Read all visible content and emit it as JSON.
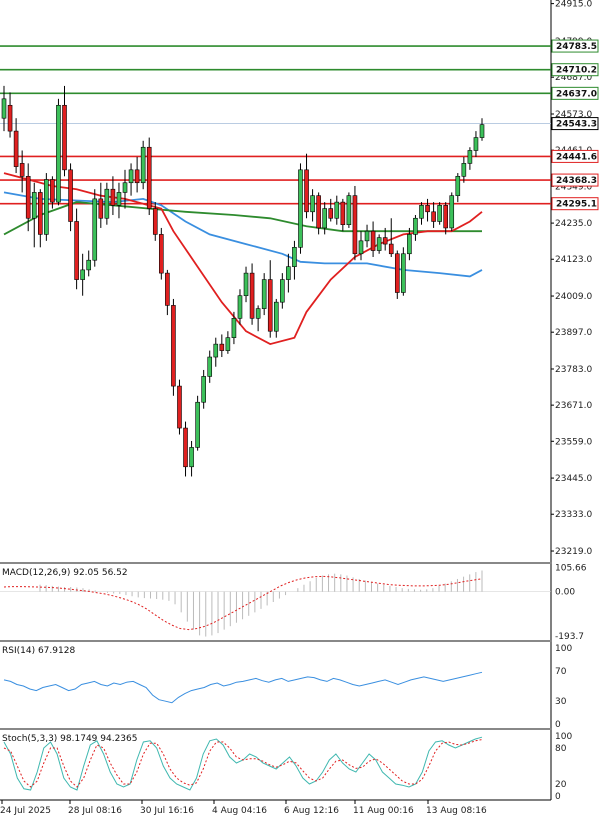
{
  "chart_data": {
    "type": "candlestick",
    "price_axis": {
      "ticks": [
        "24915.0",
        "24799.0",
        "24687.0",
        "24573.0",
        "24461.0",
        "24349.0",
        "24235.0",
        "24123.0",
        "24009.0",
        "23897.0",
        "23783.0",
        "23671.0",
        "23559.0",
        "23445.0",
        "23333.0",
        "23219.0"
      ],
      "range": [
        23185,
        24920
      ]
    },
    "date_labels": [
      "24 Jul 2025",
      "28 Jul 08:16",
      "30 Jul 16:16",
      "4 Aug 04:16",
      "6 Aug 12:16",
      "11 Aug 00:16",
      "13 Aug 08:16"
    ],
    "candles": [
      [
        24560,
        24660,
        24520,
        24620
      ],
      [
        24600,
        24640,
        24500,
        24520
      ],
      [
        24520,
        24560,
        24390,
        24410
      ],
      [
        24420,
        24460,
        24330,
        24380
      ],
      [
        24380,
        24420,
        24210,
        24250
      ],
      [
        24250,
        24360,
        24160,
        24330
      ],
      [
        24330,
        24340,
        24160,
        24200
      ],
      [
        24200,
        24390,
        24180,
        24370
      ],
      [
        24370,
        24380,
        24280,
        24300
      ],
      [
        24300,
        24620,
        24290,
        24600
      ],
      [
        24600,
        24660,
        24380,
        24400
      ],
      [
        24400,
        24420,
        24210,
        24240
      ],
      [
        24240,
        24280,
        24030,
        24060
      ],
      [
        24060,
        24140,
        24010,
        24090
      ],
      [
        24090,
        24150,
        24070,
        24120
      ],
      [
        24120,
        24340,
        24100,
        24310
      ],
      [
        24310,
        24360,
        24220,
        24250
      ],
      [
        24250,
        24360,
        24230,
        24340
      ],
      [
        24340,
        24380,
        24260,
        24290
      ],
      [
        24290,
        24360,
        24250,
        24330
      ],
      [
        24330,
        24400,
        24280,
        24360
      ],
      [
        24360,
        24420,
        24320,
        24400
      ],
      [
        24400,
        24440,
        24330,
        24360
      ],
      [
        24360,
        24490,
        24340,
        24470
      ],
      [
        24470,
        24500,
        24260,
        24280
      ],
      [
        24280,
        24300,
        24180,
        24200
      ],
      [
        24200,
        24220,
        24060,
        24080
      ],
      [
        24080,
        24090,
        23950,
        23980
      ],
      [
        23980,
        24000,
        23700,
        23730
      ],
      [
        23730,
        23750,
        23580,
        23600
      ],
      [
        23600,
        23620,
        23450,
        23480
      ],
      [
        23480,
        23560,
        23450,
        23540
      ],
      [
        23540,
        23700,
        23530,
        23680
      ],
      [
        23680,
        23780,
        23660,
        23760
      ],
      [
        23760,
        23840,
        23740,
        23820
      ],
      [
        23820,
        23880,
        23790,
        23860
      ],
      [
        23860,
        23890,
        23820,
        23840
      ],
      [
        23840,
        23900,
        23830,
        23880
      ],
      [
        23880,
        23960,
        23860,
        23940
      ],
      [
        23940,
        24030,
        23920,
        24010
      ],
      [
        24010,
        24100,
        23990,
        24080
      ],
      [
        24080,
        24110,
        23920,
        23940
      ],
      [
        23940,
        23980,
        23900,
        23970
      ],
      [
        23970,
        24080,
        23950,
        24060
      ],
      [
        24060,
        24120,
        23880,
        23900
      ],
      [
        23900,
        24000,
        23880,
        23990
      ],
      [
        23990,
        24080,
        23970,
        24060
      ],
      [
        24060,
        24140,
        24020,
        24100
      ],
      [
        24100,
        24180,
        24060,
        24160
      ],
      [
        24160,
        24420,
        24140,
        24400
      ],
      [
        24400,
        24450,
        24250,
        24270
      ],
      [
        24270,
        24340,
        24240,
        24320
      ],
      [
        24320,
        24330,
        24200,
        24220
      ],
      [
        24220,
        24300,
        24200,
        24280
      ],
      [
        24280,
        24310,
        24240,
        24250
      ],
      [
        24250,
        24320,
        24230,
        24300
      ],
      [
        24300,
        24310,
        24210,
        24230
      ],
      [
        24230,
        24330,
        24220,
        24320
      ],
      [
        24320,
        24350,
        24120,
        24140
      ],
      [
        24140,
        24210,
        24120,
        24180
      ],
      [
        24180,
        24230,
        24160,
        24210
      ],
      [
        24210,
        24240,
        24130,
        24150
      ],
      [
        24150,
        24200,
        24140,
        24190
      ],
      [
        24190,
        24220,
        24150,
        24170
      ],
      [
        24170,
        24250,
        24130,
        24140
      ],
      [
        24140,
        24150,
        24000,
        24020
      ],
      [
        24020,
        24160,
        24010,
        24140
      ],
      [
        24140,
        24220,
        24120,
        24200
      ],
      [
        24200,
        24260,
        24180,
        24250
      ],
      [
        24250,
        24300,
        24230,
        24290
      ],
      [
        24290,
        24310,
        24240,
        24270
      ],
      [
        24270,
        24300,
        24220,
        24240
      ],
      [
        24240,
        24300,
        24230,
        24290
      ],
      [
        24290,
        24300,
        24200,
        24220
      ],
      [
        24220,
        24330,
        24210,
        24320
      ],
      [
        24320,
        24390,
        24300,
        24380
      ],
      [
        24380,
        24440,
        24360,
        24420
      ],
      [
        24420,
        24470,
        24400,
        24460
      ],
      [
        24460,
        24520,
        24440,
        24500
      ],
      [
        24500,
        24560,
        24490,
        24540
      ]
    ],
    "ma_blue": [
      [
        0,
        24330
      ],
      [
        6,
        24310
      ],
      [
        12,
        24305
      ],
      [
        18,
        24300
      ],
      [
        23,
        24310
      ],
      [
        26,
        24290
      ],
      [
        30,
        24240
      ],
      [
        34,
        24200
      ],
      [
        40,
        24170
      ],
      [
        46,
        24140
      ],
      [
        49,
        24115
      ],
      [
        53,
        24110
      ],
      [
        60,
        24110
      ],
      [
        66,
        24090
      ],
      [
        72,
        24080
      ],
      [
        77,
        24070
      ],
      [
        79,
        24090
      ]
    ],
    "ma_green": [
      [
        0,
        24200
      ],
      [
        6,
        24260
      ],
      [
        12,
        24300
      ],
      [
        18,
        24290
      ],
      [
        24,
        24280
      ],
      [
        30,
        24270
      ],
      [
        38,
        24260
      ],
      [
        44,
        24250
      ],
      [
        50,
        24225
      ],
      [
        56,
        24210
      ],
      [
        64,
        24210
      ],
      [
        72,
        24210
      ],
      [
        79,
        24210
      ]
    ],
    "ma_red": [
      [
        0,
        24390
      ],
      [
        4,
        24370
      ],
      [
        8,
        24350
      ],
      [
        12,
        24340
      ],
      [
        16,
        24320
      ],
      [
        20,
        24310
      ],
      [
        26,
        24280
      ],
      [
        28,
        24210
      ],
      [
        32,
        24100
      ],
      [
        36,
        23990
      ],
      [
        40,
        23900
      ],
      [
        44,
        23860
      ],
      [
        48,
        23880
      ],
      [
        50,
        23960
      ],
      [
        54,
        24060
      ],
      [
        58,
        24130
      ],
      [
        62,
        24170
      ],
      [
        66,
        24200
      ],
      [
        70,
        24210
      ],
      [
        74,
        24210
      ],
      [
        77,
        24240
      ],
      [
        79,
        24270
      ]
    ],
    "levels_green": [
      {
        "value": 24783.5,
        "label": "24783.5"
      },
      {
        "value": 24710.2,
        "label": "24710.2"
      },
      {
        "value": 24637.0,
        "label": "24637.0"
      }
    ],
    "levels_red": [
      {
        "value": 24441.6,
        "label": "24441.6"
      },
      {
        "value": 24368.3,
        "label": "24368.3"
      },
      {
        "value": 24295.1,
        "label": "24295.1"
      }
    ],
    "current_price": {
      "value": 24543.3,
      "label": "24543.3"
    },
    "macd": {
      "title": "MACD(12,26,9) 92.05 56.52",
      "ticks": [
        "105.66",
        "0.00",
        "-193.7"
      ],
      "range": [
        -210,
        120
      ],
      "histogram": [
        30,
        28,
        25,
        22,
        20,
        20,
        18,
        15,
        10,
        5,
        0,
        -5,
        -8,
        -10,
        -15,
        -20,
        -25,
        -28,
        -30,
        -32,
        -35,
        -40,
        -55,
        -90,
        -130,
        -165,
        -190,
        -195,
        -190,
        -180,
        -165,
        -150,
        -135,
        -120,
        -105,
        -90,
        -75,
        -60,
        -45,
        -30,
        -15,
        0,
        15,
        30,
        45,
        60,
        70,
        75,
        78,
        75,
        70,
        62,
        55,
        48,
        40,
        35,
        30,
        25,
        20,
        15,
        12,
        10,
        8,
        10,
        15,
        25,
        35,
        45,
        55,
        65,
        75,
        85,
        92
      ],
      "signal": [
        20,
        22,
        22,
        21,
        20,
        19,
        17,
        14,
        10,
        6,
        2,
        -4,
        -10,
        -18,
        -28,
        -40,
        -55,
        -75,
        -100,
        -125,
        -145,
        -160,
        -165,
        -160,
        -150,
        -135,
        -115,
        -95,
        -75,
        -55,
        -35,
        -15,
        5,
        25,
        40,
        52,
        60,
        65,
        66,
        64,
        60,
        55,
        50,
        45,
        40,
        35,
        30,
        28,
        26,
        25,
        25,
        26,
        28,
        32,
        38,
        45,
        50,
        56
      ]
    },
    "rsi": {
      "title": "RSI(14) 67.9128",
      "ticks": [
        "100",
        "70",
        "30",
        "0"
      ],
      "range": [
        0,
        100
      ],
      "values": [
        58,
        56,
        52,
        50,
        46,
        44,
        48,
        50,
        52,
        48,
        44,
        46,
        52,
        54,
        56,
        52,
        50,
        54,
        52,
        55,
        56,
        52,
        48,
        38,
        32,
        30,
        28,
        35,
        40,
        44,
        46,
        48,
        52,
        54,
        50,
        52,
        55,
        56,
        58,
        60,
        57,
        55,
        58,
        60,
        56,
        58,
        60,
        62,
        61,
        58,
        56,
        60,
        58,
        55,
        52,
        50,
        52,
        54,
        56,
        58,
        55,
        52,
        55,
        58,
        60,
        62,
        60,
        58,
        56,
        58,
        60,
        62,
        64,
        66,
        68
      ]
    },
    "stoch": {
      "title": "Stoch(5,3,3) 98.1749 94.2365",
      "ticks": [
        "100",
        "80",
        "20",
        "0"
      ],
      "range": [
        0,
        100
      ],
      "k": [
        90,
        70,
        30,
        12,
        10,
        40,
        80,
        90,
        70,
        30,
        15,
        10,
        50,
        85,
        92,
        70,
        40,
        20,
        15,
        20,
        60,
        90,
        92,
        80,
        50,
        30,
        20,
        15,
        10,
        30,
        70,
        92,
        95,
        85,
        65,
        55,
        60,
        70,
        65,
        55,
        50,
        45,
        55,
        65,
        50,
        30,
        20,
        25,
        40,
        60,
        70,
        55,
        45,
        40,
        55,
        70,
        60,
        40,
        30,
        20,
        18,
        15,
        20,
        40,
        75,
        90,
        92,
        85,
        80,
        85,
        90,
        95,
        98
      ],
      "d": [
        80,
        75,
        50,
        25,
        15,
        25,
        55,
        80,
        80,
        50,
        25,
        15,
        30,
        60,
        85,
        80,
        55,
        35,
        20,
        20,
        40,
        70,
        88,
        88,
        70,
        45,
        30,
        22,
        18,
        22,
        45,
        75,
        90,
        90,
        80,
        65,
        60,
        62,
        62,
        58,
        52,
        48,
        52,
        58,
        55,
        42,
        30,
        25,
        30,
        45,
        58,
        60,
        52,
        46,
        48,
        58,
        62,
        55,
        45,
        35,
        25,
        20,
        20,
        28,
        50,
        75,
        88,
        90,
        86,
        85,
        88,
        92,
        94
      ]
    }
  }
}
